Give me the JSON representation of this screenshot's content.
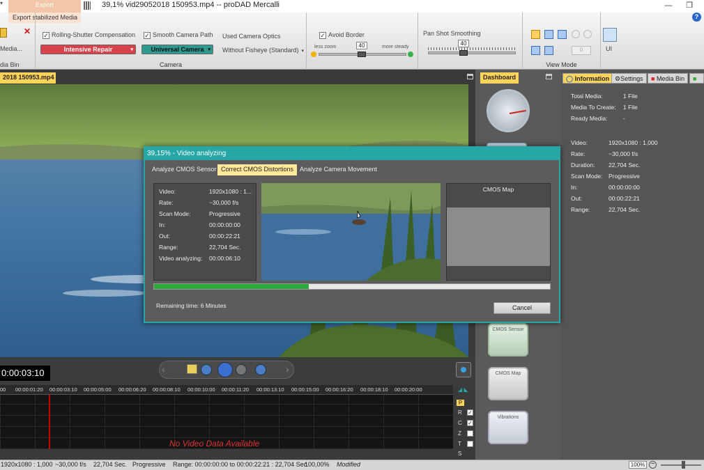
{
  "window": {
    "title": "39,1%  vid29052018 150953.mp4 -- proDAD Mercalli"
  },
  "ribbon": {
    "export_tab": "Export",
    "export_item": "Export stabilized Media",
    "media_label": "Media...",
    "media_bin_label": "dia Bin",
    "camera": {
      "rolling_shutter": "Rolling-Shutter Compensation",
      "rolling_value": "Intensive Repair",
      "smooth_path": "Smooth Camera Path",
      "smooth_value": "Universal Camera",
      "optics_label": "Used Camera Optics",
      "optics_value": "Without Fisheye (Standard)",
      "group_label": "Camera"
    },
    "border": {
      "avoid_border": "Avoid Border",
      "less_zoom": "less zoom",
      "more_steady": "more steady",
      "value": "40"
    },
    "pan": {
      "label": "Pan Shot Smoothing",
      "value": "40"
    },
    "view_mode": "View Mode",
    "ui_label": "UI",
    "spin_value": "0"
  },
  "left_panel": {
    "file_tab": "2018 150953.mp4"
  },
  "dashboard": {
    "tab": "Dashboard",
    "gauge1": "CMOS Sensor",
    "gauge2": "CMOS Map",
    "gauge3": "Vibrations"
  },
  "info_panel": {
    "tabs": [
      "Information",
      "Settings",
      "Media Bin"
    ],
    "rows": [
      {
        "label": "Total Media:",
        "value": "1 File"
      },
      {
        "label": "Media To Create:",
        "value": "1 File"
      },
      {
        "label": "Ready Media:",
        "value": "-"
      },
      {
        "label": "Video:",
        "value": "1920x1080 : 1,000"
      },
      {
        "label": "Rate:",
        "value": "~30,000 f/s"
      },
      {
        "label": "Duration:",
        "value": "22,704 Sec."
      },
      {
        "label": "Scan Mode:",
        "value": "Progressive"
      },
      {
        "label": "In:",
        "value": "00:00:00:00"
      },
      {
        "label": "Out:",
        "value": "00:00:22:21"
      },
      {
        "label": "Range:",
        "value": "22,704 Sec."
      }
    ]
  },
  "dialog": {
    "title": "39,15% - Video analyzing",
    "tabs": [
      "Analyze CMOS Sensor",
      "Correct CMOS Distortions",
      "Analyze Camera Movement"
    ],
    "active_tab": 1,
    "info": [
      {
        "label": "Video:",
        "value": "1920x1080  : 1..."
      },
      {
        "label": "Rate:",
        "value": "~30,000 f/s"
      },
      {
        "label": "Scan Mode:",
        "value": "Progressive"
      },
      {
        "label": "In:",
        "value": "00:00:00:00"
      },
      {
        "label": "Out:",
        "value": "00:00:22:21"
      },
      {
        "label": "Range:",
        "value": "22,704 Sec."
      },
      {
        "label": "Video analyzing:",
        "value": "00:00:06:10"
      }
    ],
    "cmos_map": "CMOS Map",
    "progress": 0.3915,
    "remaining": "Remaining time: 6 Minutes",
    "cancel": "Cancel"
  },
  "player": {
    "timecode": "0:00:03:10",
    "no_data": "No Video Data Available"
  },
  "timeline": {
    "ticks": [
      "00",
      "00:00:01:20",
      "00:00:03:10",
      "00:00:05:00",
      "00:00:06:20",
      "00:00:08:10",
      "00:00:10:00",
      "00:00:11:20",
      "00:00:13:10",
      "00:00:15:00",
      "00:00:16:20",
      "00:00:18:10",
      "00:00:20:00"
    ],
    "tracks": [
      "P",
      "R",
      "C",
      "Z",
      "T",
      "S"
    ]
  },
  "status": {
    "resolution": "1920x1080 : 1,000",
    "rate": "~30,000 f/s",
    "duration": "22,704 Sec.",
    "scan": "Progressive",
    "range": "Range: 00:00:00:00 to 00:00:22:21 : 22,704 Sec.",
    "zoom": "100,00%",
    "state": "Modified",
    "zoom_box": "100%"
  },
  "colors": {
    "accent": "#27a6a6",
    "progress": "#2aa83a",
    "tab_yellow": "#ffd45a",
    "repair_red": "#d9424a",
    "camera_teal": "#2e9a90"
  }
}
